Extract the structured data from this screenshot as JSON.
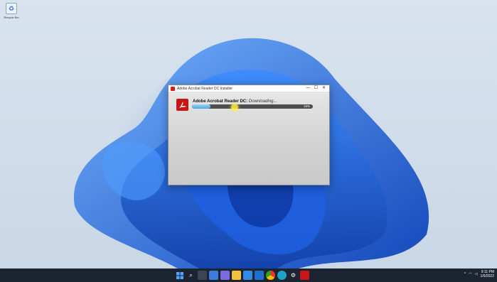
{
  "desktop": {
    "icon_label": "Recycle Bin"
  },
  "installer": {
    "window_title": "Adobe Acrobat Reader DC Installer",
    "product": "Adobe Acrobat Reader DC:",
    "state": "Downloading...",
    "progress_percent": 15,
    "progress_label": "15%",
    "controls": {
      "minimize": "—",
      "maximize": "☐",
      "close": "✕"
    }
  },
  "taskbar": {
    "apps": [
      "start",
      "search",
      "task-view",
      "widgets",
      "chat",
      "file-explorer",
      "microsoft-store",
      "mail",
      "chrome",
      "edge",
      "settings",
      "acrobat"
    ],
    "tray": {
      "time": "9:11 PM",
      "date": "1/6/2022"
    }
  },
  "colors": {
    "accent": "#c81515",
    "progress_fill": "#4aa7db",
    "taskbar": "#1b2430"
  }
}
